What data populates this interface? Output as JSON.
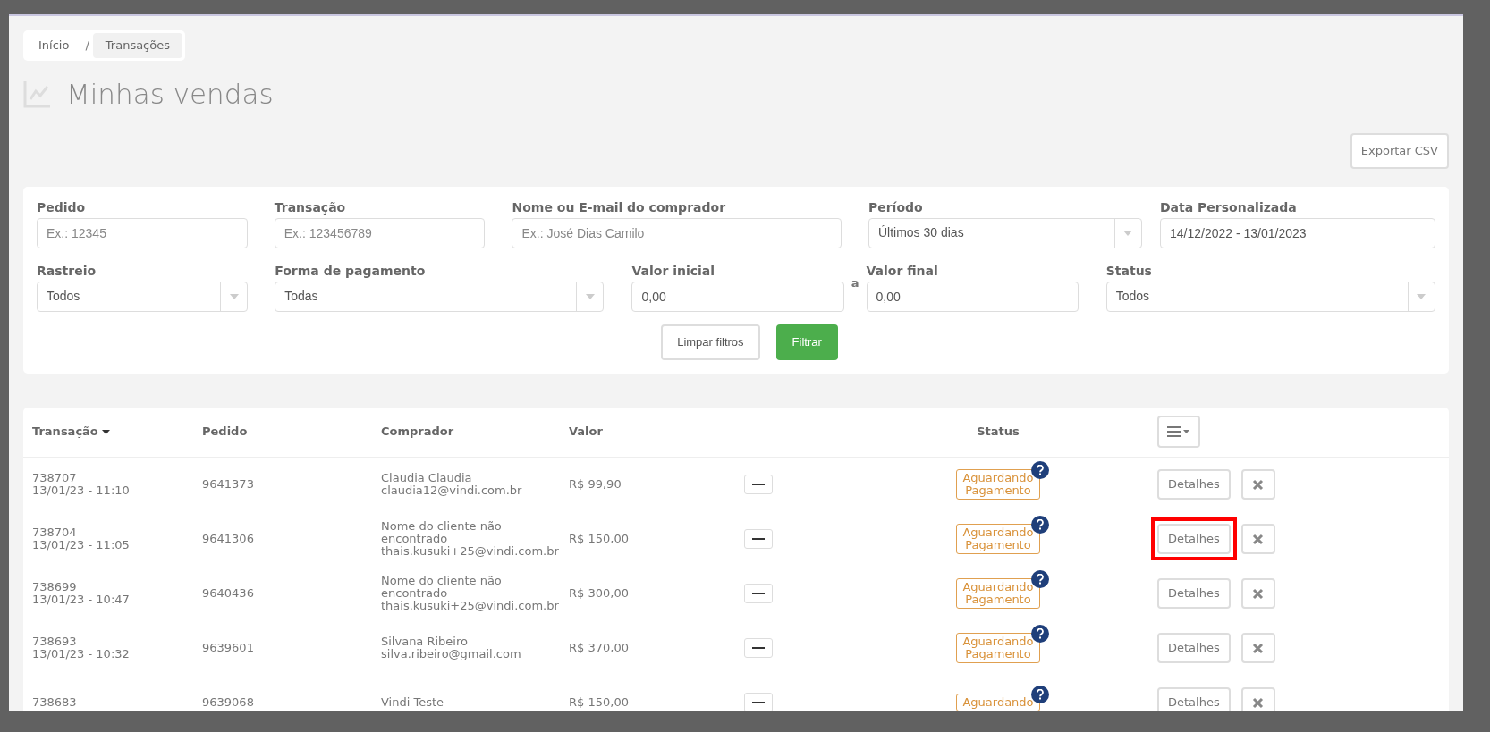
{
  "breadcrumb": [
    {
      "label": "Início",
      "selected": false
    },
    {
      "label": "Transações",
      "selected": true
    }
  ],
  "breadcrumb_separator": "/",
  "title": "Minhas vendas",
  "export_button": "Exportar CSV",
  "filters": [
    {
      "kind": "input",
      "label": "Pedido",
      "placeholder": "Ex.: 12345"
    },
    {
      "kind": "input",
      "label": "Transação",
      "placeholder": "Ex.: 123456789"
    },
    {
      "kind": "input",
      "label": "Nome ou E-mail do comprador",
      "placeholder": "Ex.: José Dias Camilo"
    },
    {
      "kind": "select",
      "label": "Período",
      "value": "Últimos 30 dias"
    },
    {
      "kind": "input",
      "label": "Data Personalizada",
      "value": "14/12/2022 - 13/01/2023"
    },
    {
      "kind": "select",
      "label": "Rastreio",
      "value": "Todos"
    },
    {
      "kind": "select",
      "label": "Forma de pagamento",
      "value": "Todas"
    },
    {
      "kind": "input",
      "label": "Valor inicial",
      "value": "0,00"
    },
    {
      "kind": "separator",
      "label": "a"
    },
    {
      "kind": "input",
      "label": "Valor final",
      "value": "0,00"
    },
    {
      "kind": "select",
      "label": "Status",
      "value": "Todos"
    }
  ],
  "filter_buttons": {
    "clear": "Limpar filtros",
    "apply": "Filtrar"
  },
  "table": {
    "columns": [
      "Transação",
      "Pedido",
      "Comprador",
      "Valor",
      "Status"
    ],
    "rows": [
      {
        "transaction": "738707",
        "date": "13/01/23 - 11:10",
        "order": "9641373",
        "buyer": [
          "Claudia Claudia",
          "claudia12@vindi.com.br"
        ],
        "value": "R$ 99,90",
        "status": [
          "Aguardando",
          "Pagamento"
        ],
        "details": "Detalhes",
        "highlighted": false
      },
      {
        "transaction": "738704",
        "date": "13/01/23 - 11:05",
        "order": "9641306",
        "buyer": [
          "Nome do cliente não",
          "encontrado",
          "thais.kusuki+25@vindi.com.br"
        ],
        "value": "R$ 150,00",
        "status": [
          "Aguardando",
          "Pagamento"
        ],
        "details": "Detalhes",
        "highlighted": true
      },
      {
        "transaction": "738699",
        "date": "13/01/23 - 10:47",
        "order": "9640436",
        "buyer": [
          "Nome do cliente não",
          "encontrado",
          "thais.kusuki+25@vindi.com.br"
        ],
        "value": "R$ 300,00",
        "status": [
          "Aguardando",
          "Pagamento"
        ],
        "details": "Detalhes",
        "highlighted": false
      },
      {
        "transaction": "738693",
        "date": "13/01/23 - 10:32",
        "order": "9639601",
        "buyer": [
          "Silvana Ribeiro",
          "silva.ribeiro@gmail.com"
        ],
        "value": "R$ 370,00",
        "status": [
          "Aguardando",
          "Pagamento"
        ],
        "details": "Detalhes",
        "highlighted": false
      },
      {
        "transaction": "738683",
        "order": "9639068",
        "buyer": [
          "Vindi Teste"
        ],
        "value": "R$ 150,00",
        "status": [
          "Aguardando"
        ],
        "details": "Detalhes",
        "highlighted": false
      }
    ]
  }
}
